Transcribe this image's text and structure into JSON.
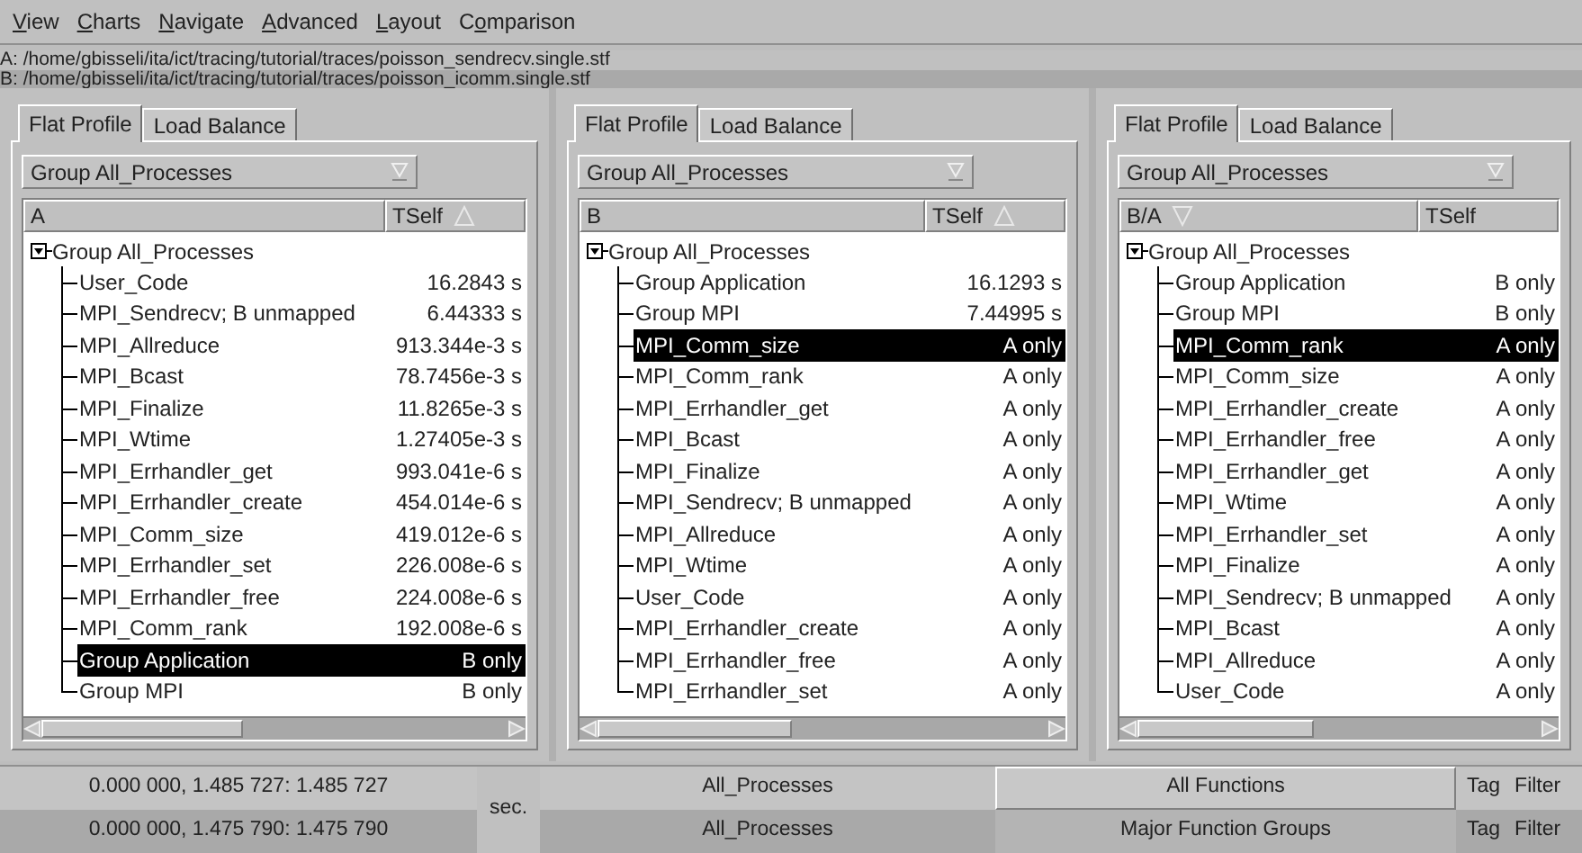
{
  "menu": [
    {
      "key": "V",
      "after": "iew"
    },
    {
      "key": "C",
      "after": "harts"
    },
    {
      "key": "N",
      "after": "avigate"
    },
    {
      "key": "A",
      "after": "dvanced"
    },
    {
      "key": "L",
      "after": "ayout"
    },
    {
      "before": "C",
      "key": "o",
      "after": "mparison"
    }
  ],
  "files": [
    {
      "text": "A: /home/gbisseli/ita/ict/tracing/tutorial/traces/poisson_sendrecv.single.stf",
      "selected": false
    },
    {
      "text": "B: /home/gbisseli/ita/ict/tracing/tutorial/traces/poisson_icomm.single.stf",
      "selected": true
    }
  ],
  "panes": [
    {
      "tabs": [
        {
          "label": "Flat Profile",
          "selected": true
        },
        {
          "label": "Load Balance",
          "selected": false
        }
      ],
      "dropdown": "Group All_Processes",
      "columns": [
        {
          "label": "A",
          "sort_ascending": false,
          "sort_descending": false
        },
        {
          "label": "TSelf",
          "sort_ascending": true,
          "sort_descending": false
        }
      ],
      "tree": {
        "label": "Group All_Processes",
        "expanded": true,
        "children": [
          {
            "name": "User_Code",
            "value": "16.2843 s",
            "selected": false
          },
          {
            "name": "MPI_Sendrecv; B unmapped",
            "value": "6.44333 s",
            "selected": false
          },
          {
            "name": "MPI_Allreduce",
            "value": "913.344e-3 s",
            "selected": false
          },
          {
            "name": "MPI_Bcast",
            "value": "78.7456e-3 s",
            "selected": false
          },
          {
            "name": "MPI_Finalize",
            "value": "11.8265e-3 s",
            "selected": false
          },
          {
            "name": "MPI_Wtime",
            "value": "1.27405e-3 s",
            "selected": false
          },
          {
            "name": "MPI_Errhandler_get",
            "value": "993.041e-6 s",
            "selected": false
          },
          {
            "name": "MPI_Errhandler_create",
            "value": "454.014e-6 s",
            "selected": false
          },
          {
            "name": "MPI_Comm_size",
            "value": "419.012e-6 s",
            "selected": false
          },
          {
            "name": "MPI_Errhandler_set",
            "value": "226.008e-6 s",
            "selected": false
          },
          {
            "name": "MPI_Errhandler_free",
            "value": "224.008e-6 s",
            "selected": false
          },
          {
            "name": "MPI_Comm_rank",
            "value": "192.008e-6 s",
            "selected": false
          },
          {
            "name": "Group Application",
            "value": "B only",
            "selected": true
          },
          {
            "name": "Group MPI",
            "value": "B only",
            "selected": false
          }
        ]
      }
    },
    {
      "tabs": [
        {
          "label": "Flat Profile",
          "selected": true
        },
        {
          "label": "Load Balance",
          "selected": false
        }
      ],
      "dropdown": "Group All_Processes",
      "columns": [
        {
          "label": "B",
          "sort_ascending": false,
          "sort_descending": false
        },
        {
          "label": "TSelf",
          "sort_ascending": true,
          "sort_descending": false
        }
      ],
      "tree": {
        "label": "Group All_Processes",
        "expanded": true,
        "children": [
          {
            "name": "Group Application",
            "value": "16.1293 s",
            "selected": false
          },
          {
            "name": "Group MPI",
            "value": "7.44995 s",
            "selected": false
          },
          {
            "name": "MPI_Comm_size",
            "value": "A only",
            "selected": true
          },
          {
            "name": "MPI_Comm_rank",
            "value": "A only",
            "selected": false
          },
          {
            "name": "MPI_Errhandler_get",
            "value": "A only",
            "selected": false
          },
          {
            "name": "MPI_Bcast",
            "value": "A only",
            "selected": false
          },
          {
            "name": "MPI_Finalize",
            "value": "A only",
            "selected": false
          },
          {
            "name": "MPI_Sendrecv; B unmapped",
            "value": "A only",
            "selected": false
          },
          {
            "name": "MPI_Allreduce",
            "value": "A only",
            "selected": false
          },
          {
            "name": "MPI_Wtime",
            "value": "A only",
            "selected": false
          },
          {
            "name": "User_Code",
            "value": "A only",
            "selected": false
          },
          {
            "name": "MPI_Errhandler_create",
            "value": "A only",
            "selected": false
          },
          {
            "name": "MPI_Errhandler_free",
            "value": "A only",
            "selected": false
          },
          {
            "name": "MPI_Errhandler_set",
            "value": "A only",
            "selected": false
          }
        ]
      }
    },
    {
      "tabs": [
        {
          "label": "Flat Profile",
          "selected": true
        },
        {
          "label": "Load Balance",
          "selected": false
        }
      ],
      "dropdown": "Group All_Processes",
      "columns": [
        {
          "label": "B/A",
          "sort_ascending": false,
          "sort_descending": true
        },
        {
          "label": "TSelf",
          "sort_ascending": false,
          "sort_descending": false
        }
      ],
      "tree": {
        "label": "Group All_Processes",
        "expanded": true,
        "children": [
          {
            "name": "Group Application",
            "value": "B only",
            "selected": false
          },
          {
            "name": "Group MPI",
            "value": "B only",
            "selected": false
          },
          {
            "name": "MPI_Comm_rank",
            "value": "A only",
            "selected": true
          },
          {
            "name": "MPI_Comm_size",
            "value": "A only",
            "selected": false
          },
          {
            "name": "MPI_Errhandler_create",
            "value": "A only",
            "selected": false
          },
          {
            "name": "MPI_Errhandler_free",
            "value": "A only",
            "selected": false
          },
          {
            "name": "MPI_Errhandler_get",
            "value": "A only",
            "selected": false
          },
          {
            "name": "MPI_Wtime",
            "value": "A only",
            "selected": false
          },
          {
            "name": "MPI_Errhandler_set",
            "value": "A only",
            "selected": false
          },
          {
            "name": "MPI_Finalize",
            "value": "A only",
            "selected": false
          },
          {
            "name": "MPI_Sendrecv; B unmapped",
            "value": "A only",
            "selected": false
          },
          {
            "name": "MPI_Bcast",
            "value": "A only",
            "selected": false
          },
          {
            "name": "MPI_Allreduce",
            "value": "A only",
            "selected": false
          },
          {
            "name": "User_Code",
            "value": "A only",
            "selected": false
          }
        ]
      }
    }
  ],
  "status": {
    "unit": "sec.",
    "rows": [
      {
        "range": "0.000 000, 1.485 727: 1.485 727",
        "process_group": "All_Processes",
        "function_group": "All Functions",
        "tag": "Tag",
        "filter": "Filter",
        "selected": true
      },
      {
        "range": "0.000 000, 1.475 790: 1.475 790",
        "process_group": "All_Processes",
        "function_group": "Major Function Groups",
        "tag": "Tag",
        "filter": "Filter",
        "selected": false
      }
    ]
  }
}
